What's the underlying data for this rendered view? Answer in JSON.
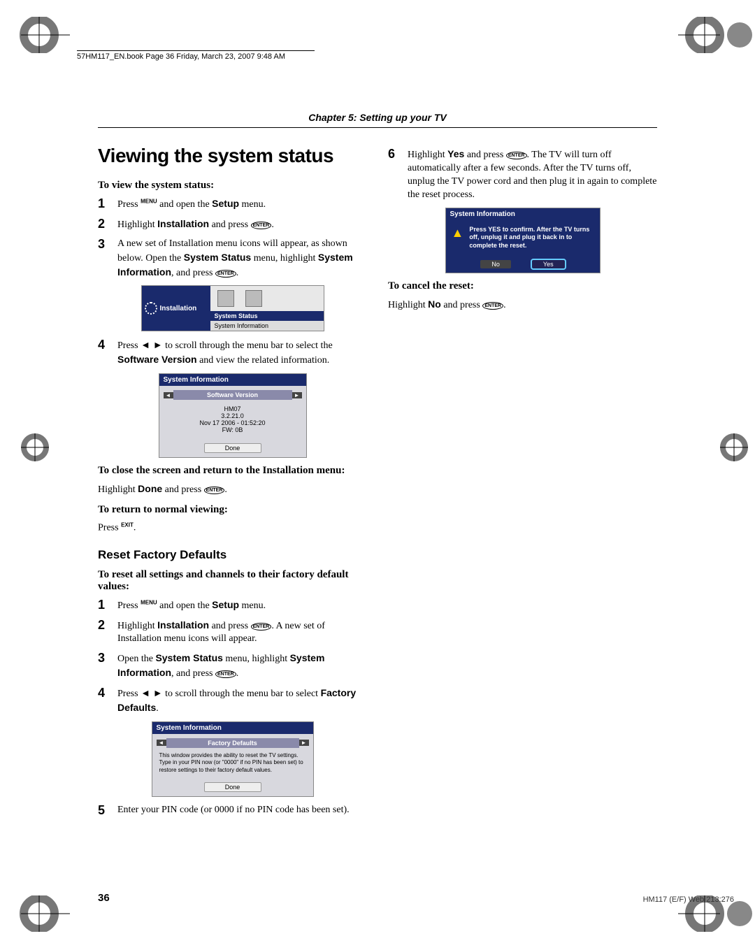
{
  "meta": {
    "booknote": "57HM117_EN.book  Page 36  Friday, March 23, 2007  9:48 AM",
    "chapter": "Chapter 5: Setting up your TV",
    "page_number": "36",
    "footer": "HM117 (E/F) Web 213:276"
  },
  "left": {
    "title": "Viewing the system status",
    "head1": "To view the system status:",
    "step1": {
      "n": "1",
      "a": "Press ",
      "menu": "MENU",
      "b": " and open the ",
      "setup": "Setup",
      "c": " menu."
    },
    "step2": {
      "n": "2",
      "a": "Highlight ",
      "inst": "Installation",
      "b": " and press ",
      "enter": "ENTER",
      "c": "."
    },
    "step3": {
      "n": "3",
      "t": "A new set of Installation menu icons will appear, as shown below. Open the ",
      "ss": "System Status",
      "t2": " menu, highlight ",
      "si": "System Information",
      "t3": ", and press ",
      "enter": "ENTER",
      "t4": "."
    },
    "ss1": {
      "side": "Installation",
      "sel": "System Status",
      "sub": "System Information"
    },
    "step4": {
      "n": "4",
      "a": "Press ",
      "arrows": "◄ ►",
      "b": " to scroll through the menu bar to select the ",
      "sv": "Software Version",
      "c": " and view the related information."
    },
    "ss2": {
      "title": "System Information",
      "tab": "Software Version",
      "l1": "HM07",
      "l2": "3.2.21.0",
      "l3": "Nov 17 2006 - 01:52:20",
      "l4": "FW:  0B",
      "btn": "Done"
    },
    "head2a": "To close the screen and return to the Installation menu:",
    "para2a_a": "Highlight ",
    "para2a_done": "Done",
    "para2a_b": " and press ",
    "para2a_enter": "ENTER",
    "para2a_c": ".",
    "head2b": "To return to normal viewing:",
    "para2b_a": "Press ",
    "para2b_exit": "EXIT",
    "para2b_b": ".",
    "sub2": "Reset Factory Defaults",
    "head3": "To reset all settings and channels to their factory default values:",
    "r1": {
      "n": "1",
      "a": "Press ",
      "menu": "MENU",
      "b": " and open the ",
      "setup": "Setup",
      "c": " menu."
    },
    "r2": {
      "n": "2",
      "a": "Highlight ",
      "inst": "Installation",
      "b": " and press ",
      "enter": "ENTER",
      "c": ". A new set of Installation menu icons will appear."
    },
    "r3": {
      "n": "3",
      "a": "Open the ",
      "ss": "System Status",
      "b": " menu, highlight ",
      "si": "System Information",
      "c": ", and press ",
      "enter": "ENTER",
      "d": "."
    },
    "r4": {
      "n": "4",
      "a": "Press ",
      "arrows": "◄ ►",
      "b": " to scroll through the menu bar to select ",
      "fd": "Factory Defaults",
      "c": "."
    },
    "ss3": {
      "title": "System Information",
      "tab": "Factory Defaults",
      "body": "This window provides the ability to reset the TV settings. Type in your PIN now  (or \"0000\"  if no PIN has been set) to restore settings to their factory default values.",
      "btn": "Done"
    },
    "r5": {
      "n": "5",
      "t": "Enter your PIN code (or 0000 if no PIN code has been set)."
    }
  },
  "right": {
    "step6": {
      "n": "6",
      "a": "Highlight ",
      "yes": "Yes",
      "b": " and press ",
      "enter": "ENTER",
      "c": ". The TV will turn off automatically after a few seconds. After the TV turns off, unplug the TV power cord and then plug it in again to complete the reset process."
    },
    "ss4": {
      "title": "System Information",
      "warn": "Press YES to confirm. After the TV turns off, unplug it and plug it back in to complete the reset.",
      "no": "No",
      "yes": "Yes"
    },
    "head": "To cancel the reset:",
    "para_a": "Highlight ",
    "para_no": "No",
    "para_b": " and press ",
    "para_enter": "ENTER",
    "para_c": "."
  }
}
